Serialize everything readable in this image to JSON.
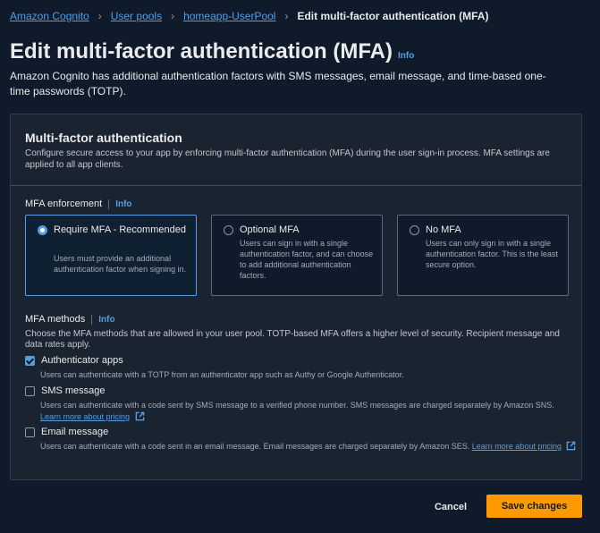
{
  "breadcrumb": {
    "items": [
      "Amazon Cognito",
      "User pools",
      "homeapp-UserPool"
    ],
    "current": "Edit multi-factor authentication (MFA)"
  },
  "header": {
    "title": "Edit multi-factor authentication (MFA)",
    "info": "Info",
    "description": "Amazon Cognito has additional authentication factors with SMS messages, email message, and time-based one-time passwords (TOTP)."
  },
  "section": {
    "title": "Multi-factor authentication",
    "description": "Configure secure access to your app by enforcing multi-factor authentication (MFA) during the user sign-in process. MFA settings are applied to all app clients."
  },
  "enforcement": {
    "label": "MFA enforcement",
    "info": "Info",
    "selected": "require",
    "options": [
      {
        "title": "Require MFA - Recommended",
        "desc": "Users must provide an additional authentication factor when signing in."
      },
      {
        "title": "Optional MFA",
        "desc": "Users can sign in with a single authentication factor, and can choose to add additional authentication factors."
      },
      {
        "title": "No MFA",
        "desc": "Users can only sign in with a single authentication factor. This is the least secure option."
      }
    ]
  },
  "methods": {
    "label": "MFA methods",
    "info": "Info",
    "description": "Choose the MFA methods that are allowed in your user pool. TOTP-based MFA offers a higher level of security. Recipient message and data rates apply.",
    "items": [
      {
        "label": "Authenticator apps",
        "checked": true,
        "desc": "Users can authenticate with a TOTP from an authenticator app such as Authy or Google Authenticator."
      },
      {
        "label": "SMS message",
        "checked": false,
        "desc": "Users can authenticate with a code sent by SMS message to a verified phone number. SMS messages are charged separately by Amazon SNS.",
        "link": "Learn more about pricing"
      },
      {
        "label": "Email message",
        "checked": false,
        "desc": "Users can authenticate with a code sent in an email message. Email messages are charged separately by Amazon SES.",
        "link": "Learn more about pricing"
      }
    ]
  },
  "footer": {
    "cancel": "Cancel",
    "save": "Save changes"
  },
  "colors": {
    "background": "#0f1b2a",
    "link": "#539fe5",
    "primary_button": "#ff9900"
  }
}
